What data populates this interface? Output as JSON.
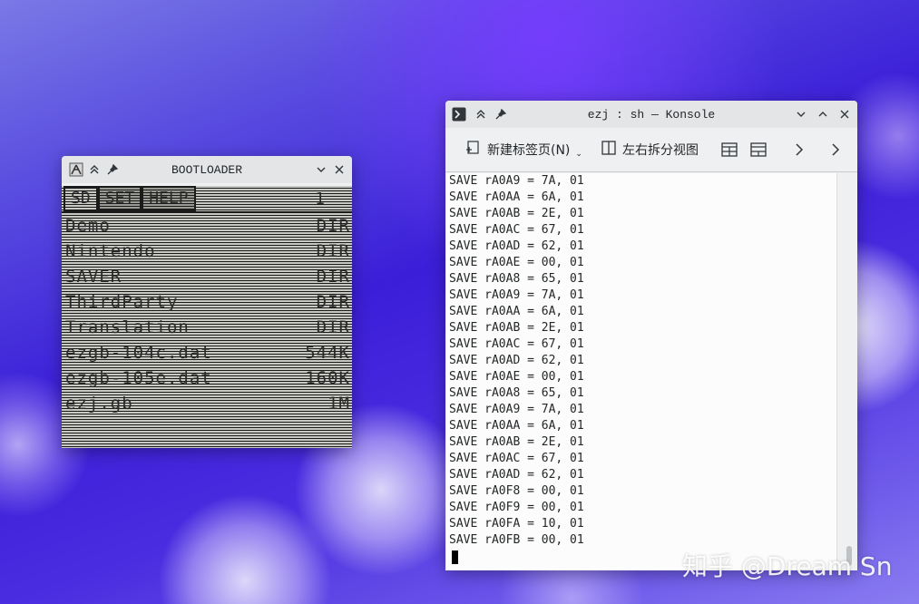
{
  "boot_window": {
    "title": "BOOTLOADER",
    "tabs": [
      "SD",
      "SET",
      "HELP"
    ],
    "page": "1",
    "files": [
      {
        "name": "Demo",
        "size": "DIR"
      },
      {
        "name": "Nintendo",
        "size": "DIR"
      },
      {
        "name": "SAVER",
        "size": "DIR"
      },
      {
        "name": "ThirdParty",
        "size": "DIR"
      },
      {
        "name": "Translation",
        "size": "DIR"
      },
      {
        "name": "ezgb-104c.dat",
        "size": "544K"
      },
      {
        "name": "ezgb-105e.dat",
        "size": "160K"
      },
      {
        "name": "ezj.gb",
        "size": "1M"
      }
    ]
  },
  "konsole": {
    "title": "ezj : sh — Konsole",
    "toolbar": {
      "new_tab": "新建标签页(N)",
      "split_view": "左右拆分视图"
    },
    "lines": [
      "SAVE rA0A9 = 7A, 01",
      "SAVE rA0AA = 6A, 01",
      "SAVE rA0AB = 2E, 01",
      "SAVE rA0AC = 67, 01",
      "SAVE rA0AD = 62, 01",
      "SAVE rA0AE = 00, 01",
      "SAVE rA0A8 = 65, 01",
      "SAVE rA0A9 = 7A, 01",
      "SAVE rA0AA = 6A, 01",
      "SAVE rA0AB = 2E, 01",
      "SAVE rA0AC = 67, 01",
      "SAVE rA0AD = 62, 01",
      "SAVE rA0AE = 00, 01",
      "SAVE rA0A8 = 65, 01",
      "SAVE rA0A9 = 7A, 01",
      "SAVE rA0AA = 6A, 01",
      "SAVE rA0AB = 2E, 01",
      "SAVE rA0AC = 67, 01",
      "SAVE rA0AD = 62, 01",
      "SAVE rA0F8 = 00, 01",
      "SAVE rA0F9 = 00, 01",
      "SAVE rA0FA = 10, 01",
      "SAVE rA0FB = 00, 01"
    ]
  },
  "watermark": "知乎 @Dream Sn"
}
